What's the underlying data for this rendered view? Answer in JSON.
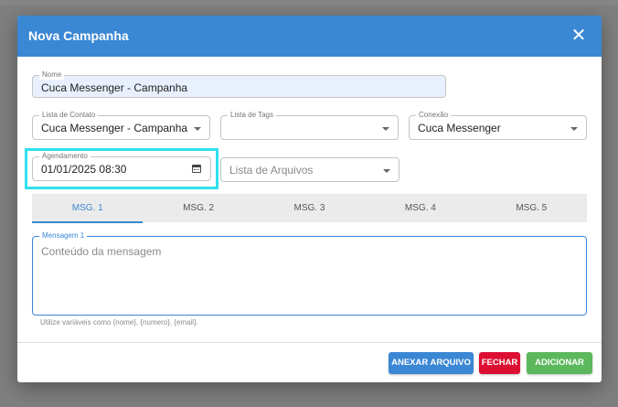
{
  "modal": {
    "title": "Nova Campanha",
    "close_icon": "close-icon"
  },
  "form": {
    "nome": {
      "label": "Nome",
      "value": "Cuca Messenger - Campanha"
    },
    "lista_contato": {
      "label": "Lista de Contato",
      "value": "Cuca Messenger - Campanha"
    },
    "lista_tags": {
      "label": "Lista de Tags",
      "value": ""
    },
    "conexao": {
      "label": "Conexão",
      "value": "Cuca Messenger"
    },
    "agendamento": {
      "label": "Agendamento",
      "value": "01/01/2025 08:30",
      "icon": "calendar-icon"
    },
    "lista_arquivos": {
      "placeholder": "Lista de Arquivos"
    }
  },
  "tabs": [
    {
      "label": "MSG. 1",
      "active": true
    },
    {
      "label": "MSG. 2",
      "active": false
    },
    {
      "label": "MSG. 3",
      "active": false
    },
    {
      "label": "MSG. 4",
      "active": false
    },
    {
      "label": "MSG. 5",
      "active": false
    }
  ],
  "message": {
    "label": "Mensagem 1",
    "placeholder": "Conteúdo da mensagem",
    "hint": "Utilize variáveis como {nome}, {numero}, {email}."
  },
  "actions": {
    "attach": "ANEXAR ARQUIVO",
    "close": "FECHAR",
    "add": "ADICIONAR"
  },
  "colors": {
    "primary": "#3a87d4",
    "danger": "#dc0f32",
    "success": "#5cb85c",
    "highlight": "#30e0f0"
  }
}
